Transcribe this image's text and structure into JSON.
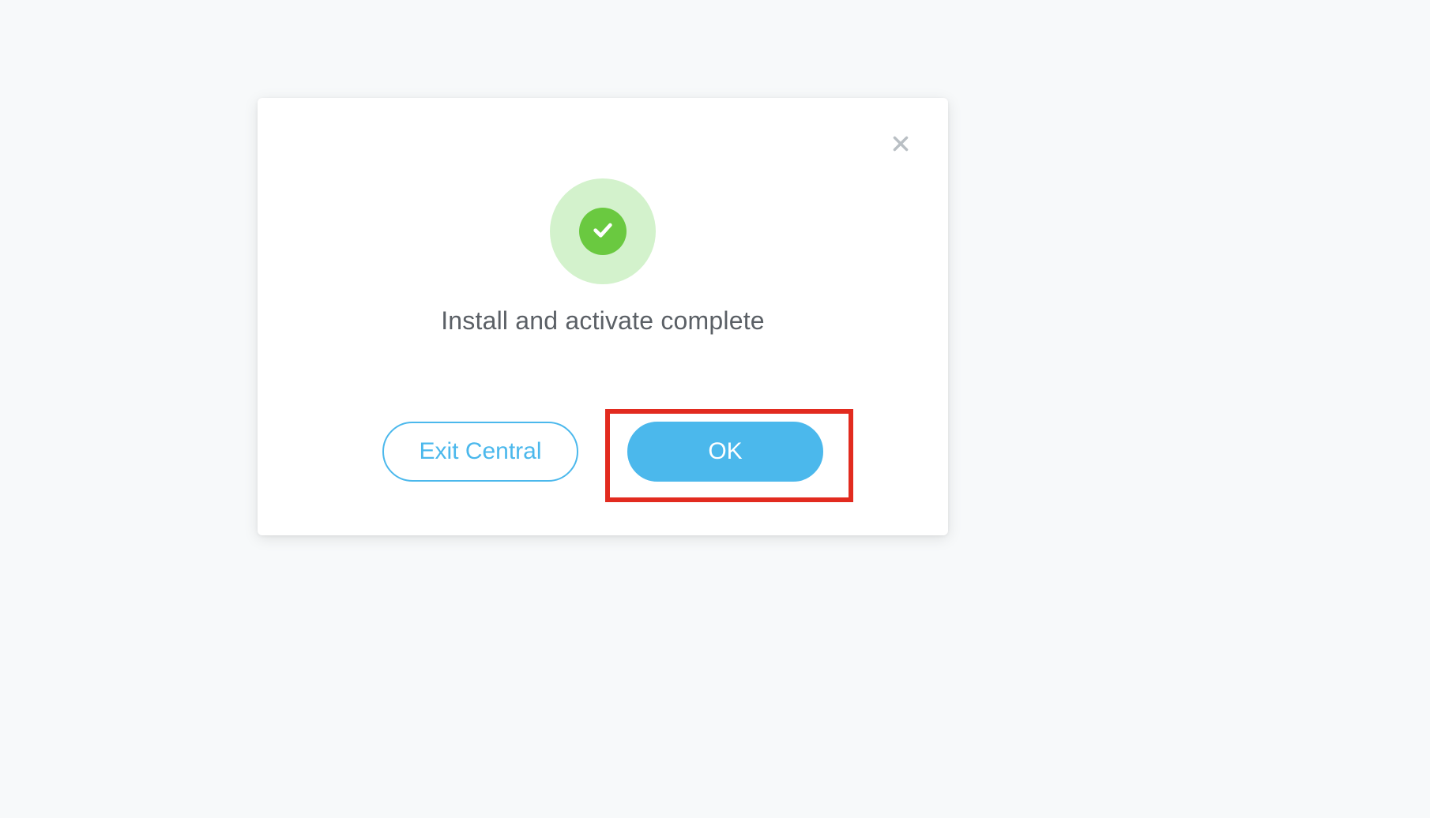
{
  "dialog": {
    "message": "Install and activate complete",
    "buttons": {
      "exit_label": "Exit Central",
      "ok_label": "OK"
    },
    "icons": {
      "close": "close-icon",
      "success": "checkmark-icon"
    }
  },
  "colors": {
    "accent": "#4bb8ec",
    "success": "#6ac940",
    "success_light": "#d3f2cc",
    "text": "#5b6066",
    "highlight": "#e22b1f"
  }
}
